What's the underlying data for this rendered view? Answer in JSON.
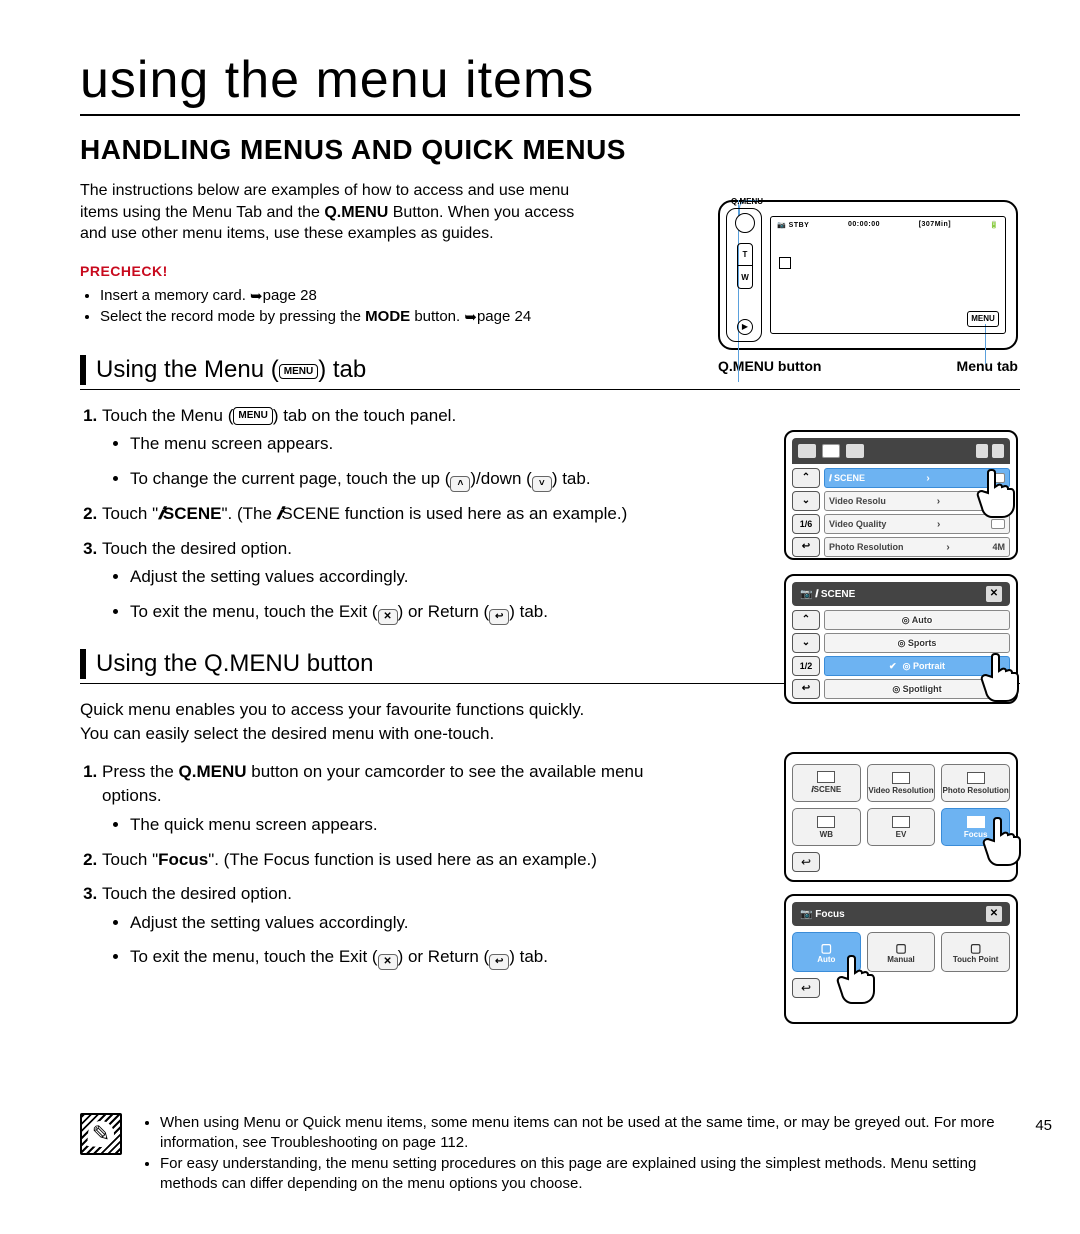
{
  "chapterTitle": "using the menu items",
  "sectionTitle": "HANDLING MENUS AND QUICK MENUS",
  "introLines": [
    "The instructions below are examples of how to access and use menu",
    "items using the Menu Tab and the ",
    " Button. When you access",
    "and use other menu items, use these examples as guides."
  ],
  "qmenuBold": "Q.MENU",
  "precheckLabel": "PRECHECK!",
  "precheck": {
    "item1a": "Insert a memory card. ",
    "item1b": "page 28",
    "item2a": "Select the record mode by pressing the ",
    "item2bold": "MODE",
    "item2b": " button. ",
    "item2c": "page 24"
  },
  "device": {
    "qmenuSmall": "Q.MENU",
    "T": "T",
    "W": "W",
    "menuTab": "MENU",
    "screenTop": {
      "a": "📷 STBY",
      "b": "00:00:00",
      "c": "[307Min]",
      "d": "🔋"
    },
    "label1": "Q.MENU button",
    "label2": "Menu tab"
  },
  "sub1": {
    "title_a": "Using the Menu (",
    "pill": "MENU",
    "title_b": ") tab",
    "step1a": "Touch the Menu (",
    "step1b": ") tab on the touch panel.",
    "step1_s1": "The menu screen appears.",
    "step1_s2a": "To change the current page, touch the up (",
    "step1_s2b": ")/down (",
    "step1_s2c": ") tab.",
    "step2a": "Touch \"",
    "step2scene": "SCENE",
    "step2b": "\". (The ",
    "step2c": "SCENE function is used here as an example.)",
    "step3": "Touch the desired option.",
    "step3_s1": "Adjust the setting values accordingly.",
    "step3_s2a": "To exit the menu, touch the Exit (",
    "step3_s2b": ") or Return (",
    "step3_s2c": ") tab."
  },
  "sub2": {
    "title": "Using the Q.MENU button",
    "intro1": "Quick menu enables you to access your favourite functions quickly.",
    "intro2": "You can easily select the desired menu with one-touch.",
    "step1a": "Press the ",
    "step1bold": "Q.MENU",
    "step1b": " button on your camcorder to see the available menu options.",
    "step1_s1": "The quick menu screen appears.",
    "step2a": "Touch \"",
    "step2bold": "Focus",
    "step2b": "\". (The Focus function is used here as an example.)",
    "step3": "Touch the desired option.",
    "step3_s1": "Adjust the setting values accordingly.",
    "step3_s2a": "To exit the menu, touch the Exit (",
    "step3_s2b": ") or Return (",
    "step3_s2c": ") tab."
  },
  "mock1": {
    "side": {
      "up": "⌃",
      "down": "⌄",
      "pg": "1/6",
      "ret": "↩"
    },
    "items": [
      {
        "label": "𝒊 SCENE",
        "sel": true
      },
      {
        "label": "Video Resolu"
      },
      {
        "label": "Video Quality"
      },
      {
        "label": "Photo Resolution",
        "right": "4M"
      }
    ]
  },
  "mock2": {
    "title": "𝒊 SCENE",
    "close": "✕",
    "side": {
      "up": "⌃",
      "down": "⌄",
      "pg": "1/2",
      "ret": "↩"
    },
    "items": [
      {
        "label": "Auto"
      },
      {
        "label": "Sports"
      },
      {
        "label": "Portrait",
        "sel": true,
        "check": "✔"
      },
      {
        "label": "Spotlight"
      }
    ]
  },
  "mock3": {
    "cells": [
      {
        "label": "𝒊SCENE"
      },
      {
        "label": "Video Resolution"
      },
      {
        "label": "Photo Resolution"
      },
      {
        "label": "WB"
      },
      {
        "label": "EV"
      },
      {
        "label": "Focus",
        "sel": true
      }
    ],
    "ret": "↩"
  },
  "mock4": {
    "title": "Focus",
    "close": "✕",
    "cells": [
      {
        "label": "Auto",
        "sel": true
      },
      {
        "label": "Manual"
      },
      {
        "label": "Touch Point"
      }
    ],
    "ret": "↩"
  },
  "notes": {
    "n1": "When using Menu or Quick menu items, some menu items can not be used at the same time, or may be greyed out. For more information, see Troubleshooting on page 112.",
    "n2": "For easy understanding, the menu setting procedures on this page are explained using the simplest methods. Menu setting methods can differ depending on the menu options you choose."
  },
  "pageNum": "45"
}
